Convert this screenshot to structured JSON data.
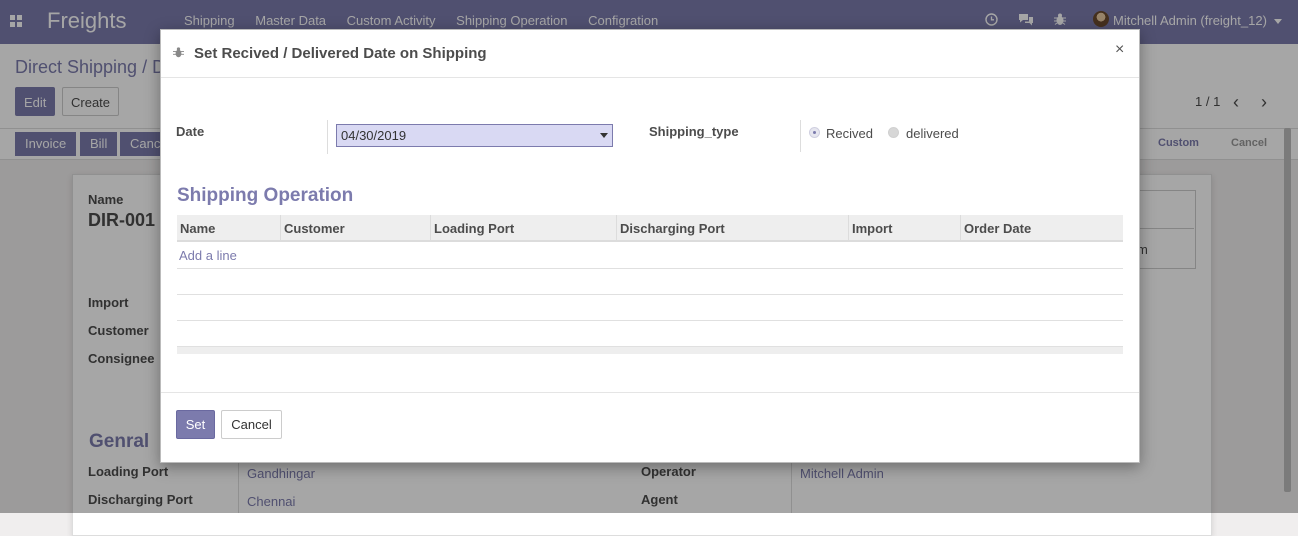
{
  "navbar": {
    "brand": "Freights",
    "menu": [
      "Shipping",
      "Master Data",
      "Custom Activity",
      "Shipping Operation",
      "Configration"
    ],
    "user": "Mitchell Admin (freight_12)",
    "icons": [
      "clock-icon",
      "chat-icon",
      "bug-icon"
    ]
  },
  "page": {
    "breadcrumb": "Direct Shipping / D",
    "edit_label": "Edit",
    "create_label": "Create",
    "pager": "1 / 1",
    "status_buttons": [
      "Invoice",
      "Bill",
      "Canc"
    ],
    "stages": [
      "Custom",
      "Cancel"
    ],
    "name_label": "Name",
    "name_value": "DIR-001",
    "import_label": "Import",
    "customer_label": "Customer",
    "consignee_label": "Consignee",
    "section": "Genral",
    "loading_port_label": "Loading Port",
    "loading_port_value": "Gandhingar",
    "discharging_port_label": "Discharging Port",
    "discharging_port_value": "Chennai",
    "operator_label": "Operator",
    "operator_value": "Mitchell Admin",
    "agent_label": "Agent",
    "right_partial": "m"
  },
  "modal": {
    "title": "Set Recived / Delivered Date on Shipping",
    "date_label": "Date",
    "date_value": "04/30/2019",
    "shipping_type_label": "Shipping_type",
    "radio_options": [
      {
        "label": "Recived",
        "checked": true
      },
      {
        "label": "delivered",
        "checked": false
      }
    ],
    "section_title": "Shipping Operation",
    "columns": [
      "Name",
      "Customer",
      "Loading Port",
      "Discharging Port",
      "Import",
      "Order Date"
    ],
    "add_line": "Add a line",
    "set_label": "Set",
    "cancel_label": "Cancel"
  },
  "colors": {
    "accent": "#7c7bad",
    "input_bg": "#d9d9f3"
  }
}
